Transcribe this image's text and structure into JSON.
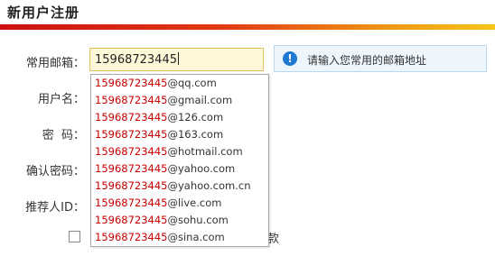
{
  "header": {
    "title": "新用户注册"
  },
  "form": {
    "email_label": "常用邮箱：",
    "username_label": "用户名：",
    "password_label": "密  码：",
    "confirm_label": "确认密码：",
    "referrer_label": "推荐人ID：",
    "email_value": "15968723445",
    "agree_tail": "款"
  },
  "tip": {
    "icon": "info-icon",
    "text": "请输入您常用的邮箱地址"
  },
  "suggestions": [
    {
      "prefix": "15968723445",
      "domain": "@qq.com"
    },
    {
      "prefix": "15968723445",
      "domain": "@gmail.com"
    },
    {
      "prefix": "15968723445",
      "domain": "@126.com"
    },
    {
      "prefix": "15968723445",
      "domain": "@163.com"
    },
    {
      "prefix": "15968723445",
      "domain": "@hotmail.com"
    },
    {
      "prefix": "15968723445",
      "domain": "@yahoo.com"
    },
    {
      "prefix": "15968723445",
      "domain": "@yahoo.com.cn"
    },
    {
      "prefix": "15968723445",
      "domain": "@live.com"
    },
    {
      "prefix": "15968723445",
      "domain": "@sohu.com"
    },
    {
      "prefix": "15968723445",
      "domain": "@sina.com"
    }
  ],
  "colors": {
    "accent_red": "#cc1010",
    "accent_yellow": "#f8c418",
    "input_bg": "#fff8d8",
    "tip_bg": "#eef6fd"
  }
}
